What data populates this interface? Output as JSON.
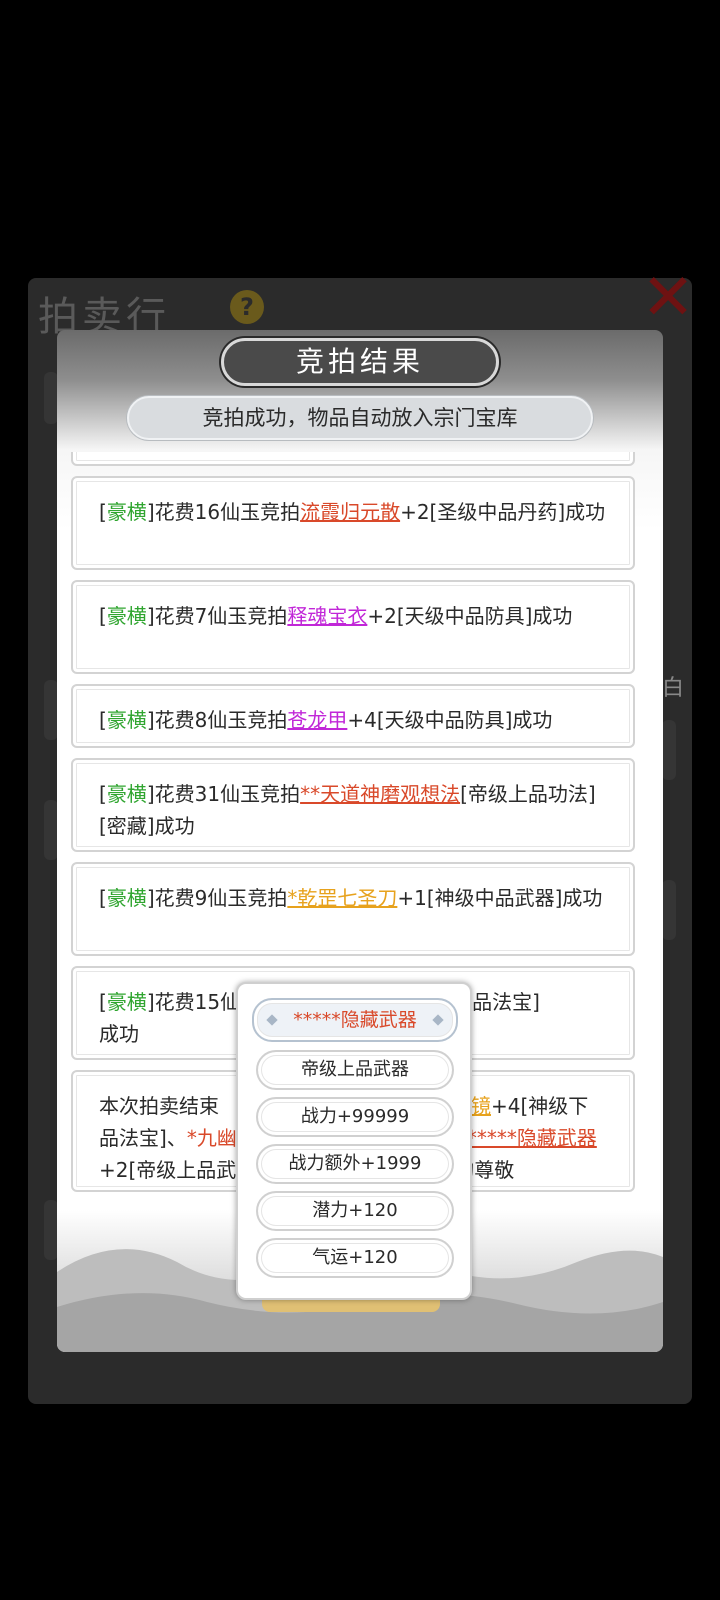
{
  "background": {
    "hall_title": "拍卖行",
    "help_icon": "question-mark-icon",
    "close_icon": "close-x-icon",
    "partial_char": "白"
  },
  "dialog": {
    "title": "竞拍结果",
    "subtitle": "竞拍成功，物品自动放入宗门宝库"
  },
  "entries": [
    {
      "tag": "豪横",
      "before": "]花费16仙玉竞拍",
      "item": "流霞归元散",
      "item_color": "#d9492a",
      "after": "+2[圣级中品丹药]成功"
    },
    {
      "tag": "豪横",
      "before": "]花费7仙玉竞拍",
      "item": "释魂宝衣",
      "item_color": "#c127d8",
      "after": "+2[天级中品防具]成功"
    },
    {
      "tag": "豪横",
      "before": "]花费8仙玉竞拍",
      "item": "苍龙甲",
      "item_color": "#c127d8",
      "after": "+4[天级中品防具]成功"
    },
    {
      "tag": "豪横",
      "before": "]花费31仙玉竞拍",
      "item": "**天道神磨观想法",
      "item_color": "#d9492a",
      "after": "[帝级上品功法][密藏]成功"
    },
    {
      "tag": "豪横",
      "before": "]花费9仙玉竞拍",
      "item": "*乾罡七圣刀",
      "item_color": "#e7a21d",
      "after": "+1[神级中品武器]成功"
    },
    {
      "tag": "豪横",
      "before": "]花费15仙",
      "gap": "",
      "after_right": "器级下品法宝]",
      "line2": "成功"
    }
  ],
  "summary": {
    "line1_left": "本次拍卖结束",
    "line1_item": "世镜",
    "line1_right": "+4[神级下",
    "line2_left": "品法宝]、",
    "line2_item_left": "*九幽",
    "line2_item_right": "*****隐藏武器",
    "line3_left": "+2[帝级上品武",
    "line3_right": "的尊敬"
  },
  "popup": {
    "options": [
      {
        "label": "*****隐藏武器",
        "selected": true
      },
      {
        "label": "帝级上品武器",
        "selected": false
      },
      {
        "label": "战力+99999",
        "selected": false
      },
      {
        "label": "战力额外+1999",
        "selected": false
      },
      {
        "label": "潜力+120",
        "selected": false
      },
      {
        "label": "气运+120",
        "selected": false
      }
    ]
  },
  "colors": {
    "tag_green": "#2fa52f",
    "rare_orange": "#d9492a",
    "epic_purple": "#c127d8",
    "legend_gold": "#e7a21d"
  }
}
